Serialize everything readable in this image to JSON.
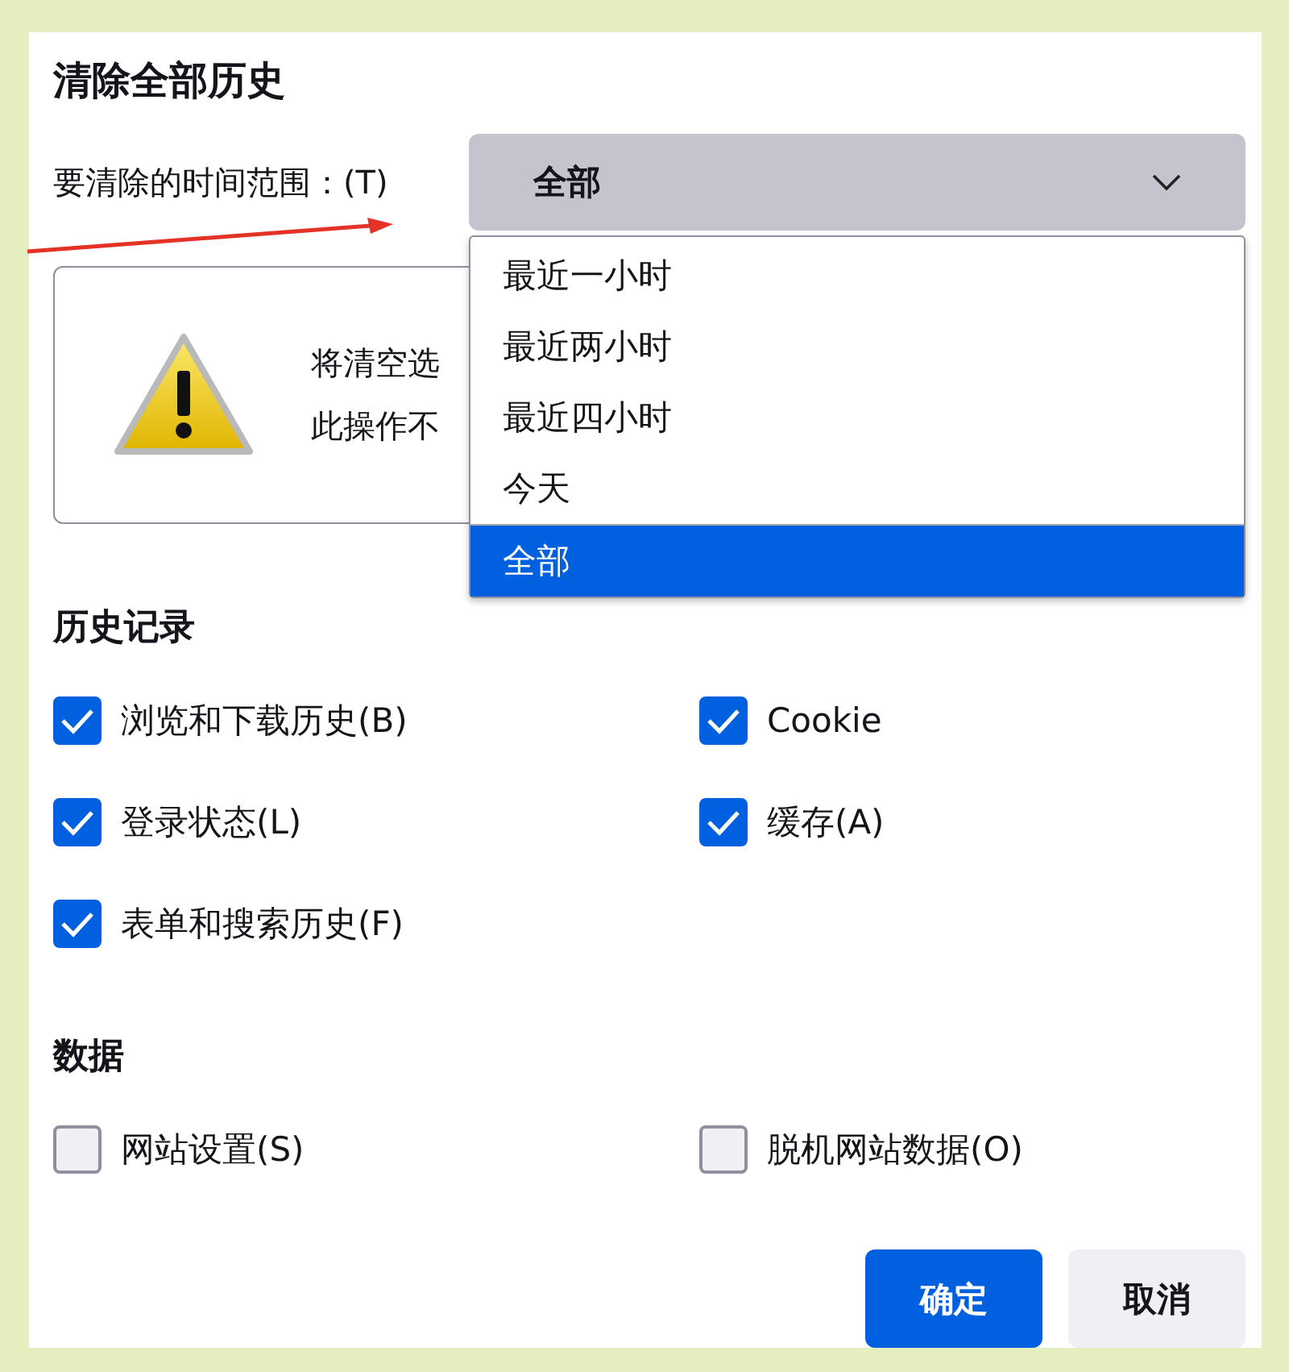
{
  "dialog": {
    "title": "清除全部历史"
  },
  "time_range": {
    "label": "要清除的时间范围：(T)",
    "value": "全部",
    "expanded": true,
    "options": [
      {
        "label": "最近一小时",
        "selected": false
      },
      {
        "label": "最近两小时",
        "selected": false
      },
      {
        "label": "最近四小时",
        "selected": false
      },
      {
        "label": "今天",
        "selected": false
      },
      {
        "label": "全部",
        "selected": true
      }
    ]
  },
  "warning": {
    "lines": [
      "将清空选",
      "此操作不"
    ]
  },
  "sections": [
    {
      "title": "历史记录",
      "items": [
        {
          "label": "浏览和下载历史(B)",
          "checked": true
        },
        {
          "label": "Cookie",
          "checked": true
        },
        {
          "label": "登录状态(L)",
          "checked": true
        },
        {
          "label": "缓存(A)",
          "checked": true
        },
        {
          "label": "表单和搜索历史(F)",
          "checked": true
        }
      ]
    },
    {
      "title": "数据",
      "items": [
        {
          "label": "网站设置(S)",
          "checked": false
        },
        {
          "label": "脱机网站数据(O)",
          "checked": false
        }
      ]
    }
  ],
  "buttons": [
    {
      "label": "确定",
      "kind": "primary"
    },
    {
      "label": "取消",
      "kind": "secondary"
    }
  ]
}
